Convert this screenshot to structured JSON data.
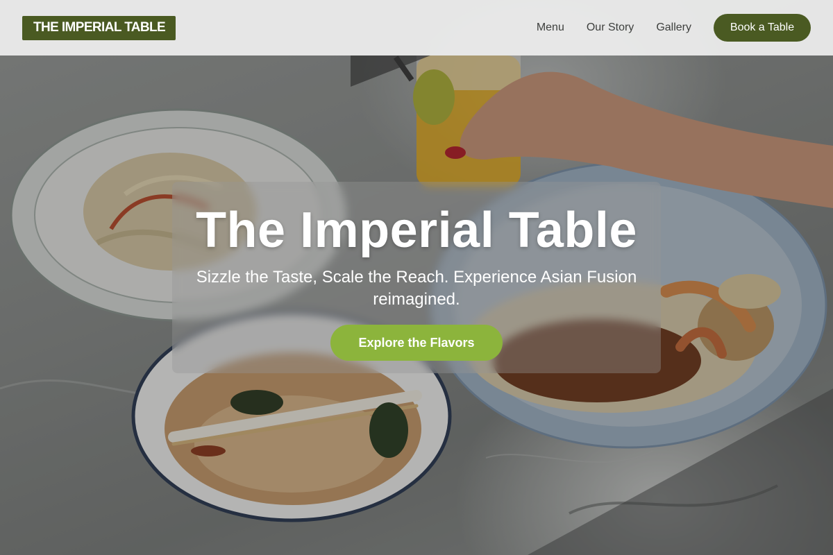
{
  "header": {
    "logo_text": "THE IMPERIAL TABLE",
    "nav": [
      {
        "label": "Menu"
      },
      {
        "label": "Our Story"
      },
      {
        "label": "Gallery"
      }
    ],
    "book_button_label": "Book a Table"
  },
  "hero": {
    "title": "The Imperial Table",
    "tagline": "Sizzle the Taste, Scale the Reach. Experience Asian Fusion reimagined.",
    "cta_label": "Explore the Flavors"
  },
  "colors": {
    "brand_dark_green": "#4a5a22",
    "cta_green": "#8cb43c",
    "header_bg": "#f0f0f0",
    "text_white": "#ffffff"
  }
}
